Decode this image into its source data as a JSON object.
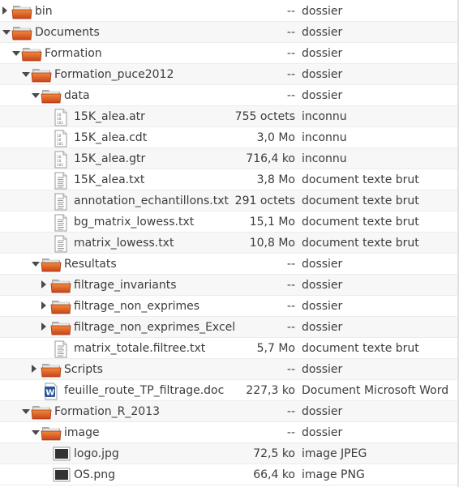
{
  "rows": [
    {
      "name": "bin",
      "size": "--",
      "type": "dossier",
      "kind": "folder",
      "depth": 0,
      "expander": "collapsed"
    },
    {
      "name": "Documents",
      "size": "--",
      "type": "dossier",
      "kind": "folder",
      "depth": 0,
      "expander": "expanded"
    },
    {
      "name": "Formation",
      "size": "--",
      "type": "dossier",
      "kind": "folder",
      "depth": 1,
      "expander": "expanded"
    },
    {
      "name": "Formation_puce2012",
      "size": "--",
      "type": "dossier",
      "kind": "folder",
      "depth": 2,
      "expander": "expanded"
    },
    {
      "name": "data",
      "size": "--",
      "type": "dossier",
      "kind": "folder",
      "depth": 3,
      "expander": "expanded"
    },
    {
      "name": "15K_alea.atr",
      "size": "755 octets",
      "type": "inconnu",
      "kind": "binary",
      "depth": 4,
      "expander": "none"
    },
    {
      "name": "15K_alea.cdt",
      "size": "3,0 Mo",
      "type": "inconnu",
      "kind": "binary",
      "depth": 4,
      "expander": "none"
    },
    {
      "name": "15K_alea.gtr",
      "size": "716,4 ko",
      "type": "inconnu",
      "kind": "binary",
      "depth": 4,
      "expander": "none"
    },
    {
      "name": "15K_alea.txt",
      "size": "3,8 Mo",
      "type": "document texte brut",
      "kind": "text",
      "depth": 4,
      "expander": "none"
    },
    {
      "name": "annotation_echantillons.txt",
      "size": "291 octets",
      "type": "document texte brut",
      "kind": "text",
      "depth": 4,
      "expander": "none"
    },
    {
      "name": "bg_matrix_lowess.txt",
      "size": "15,1 Mo",
      "type": "document texte brut",
      "kind": "text",
      "depth": 4,
      "expander": "none"
    },
    {
      "name": "matrix_lowess.txt",
      "size": "10,8 Mo",
      "type": "document texte brut",
      "kind": "text",
      "depth": 4,
      "expander": "none"
    },
    {
      "name": "Resultats",
      "size": "--",
      "type": "dossier",
      "kind": "folder",
      "depth": 3,
      "expander": "expanded"
    },
    {
      "name": "filtrage_invariants",
      "size": "--",
      "type": "dossier",
      "kind": "folder",
      "depth": 4,
      "expander": "collapsed"
    },
    {
      "name": "filtrage_non_exprimes",
      "size": "--",
      "type": "dossier",
      "kind": "folder",
      "depth": 4,
      "expander": "collapsed"
    },
    {
      "name": "filtrage_non_exprimes_Excel",
      "size": "--",
      "type": "dossier",
      "kind": "folder",
      "depth": 4,
      "expander": "collapsed"
    },
    {
      "name": "matrix_totale.filtree.txt",
      "size": "5,7 Mo",
      "type": "document texte brut",
      "kind": "text",
      "depth": 4,
      "expander": "none"
    },
    {
      "name": "Scripts",
      "size": "--",
      "type": "dossier",
      "kind": "folder",
      "depth": 3,
      "expander": "collapsed"
    },
    {
      "name": "feuille_route_TP_filtrage.doc",
      "size": "227,3 ko",
      "type": "Document Microsoft Word",
      "kind": "word",
      "depth": 3,
      "expander": "none"
    },
    {
      "name": "Formation_R_2013",
      "size": "--",
      "type": "dossier",
      "kind": "folder",
      "depth": 2,
      "expander": "expanded"
    },
    {
      "name": "image",
      "size": "--",
      "type": "dossier",
      "kind": "folder",
      "depth": 3,
      "expander": "expanded"
    },
    {
      "name": "logo.jpg",
      "size": "72,5 ko",
      "type": "image JPEG",
      "kind": "image",
      "depth": 4,
      "expander": "none"
    },
    {
      "name": "OS.png",
      "size": "66,4 ko",
      "type": "image PNG",
      "kind": "image",
      "depth": 4,
      "expander": "none"
    }
  ],
  "colors": {
    "folder_dark": "#c8431a",
    "folder_light": "#f08a3c",
    "folder_tab": "#e9e9e9",
    "word_blue": "#2b5797",
    "row_alt": "#f7f7f7"
  }
}
